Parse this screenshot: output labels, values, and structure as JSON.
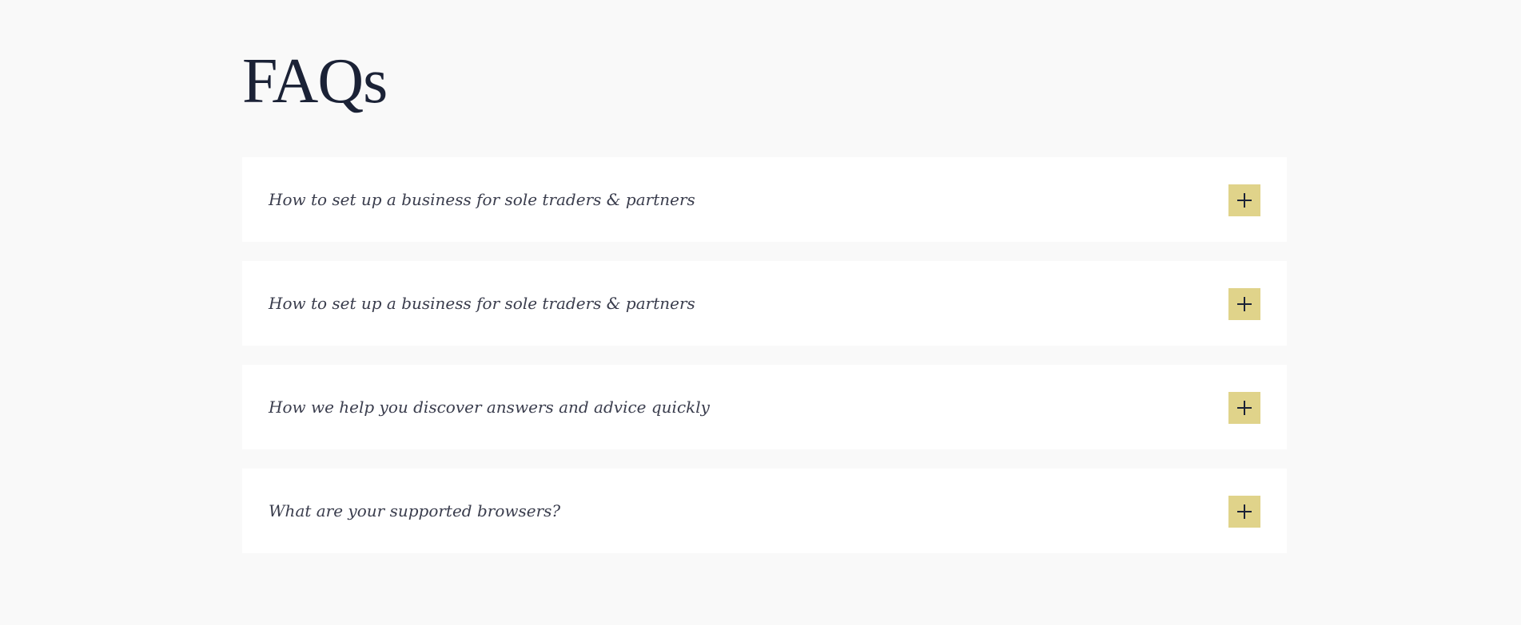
{
  "page": {
    "title": "FAQs"
  },
  "colors": {
    "background": "#f9f9f9",
    "card": "#ffffff",
    "heading": "#1b2236",
    "question_text": "#3a3d4d",
    "toggle_accent": "#e0d38a"
  },
  "faqs": [
    {
      "question": "How to set up a business for sole traders & partners",
      "icon": "plus-icon"
    },
    {
      "question": "How to set up a business for sole traders & partners",
      "icon": "plus-icon"
    },
    {
      "question": "How we help you discover answers and advice quickly",
      "icon": "plus-icon"
    },
    {
      "question": "What are your supported browsers?",
      "icon": "plus-icon"
    }
  ]
}
